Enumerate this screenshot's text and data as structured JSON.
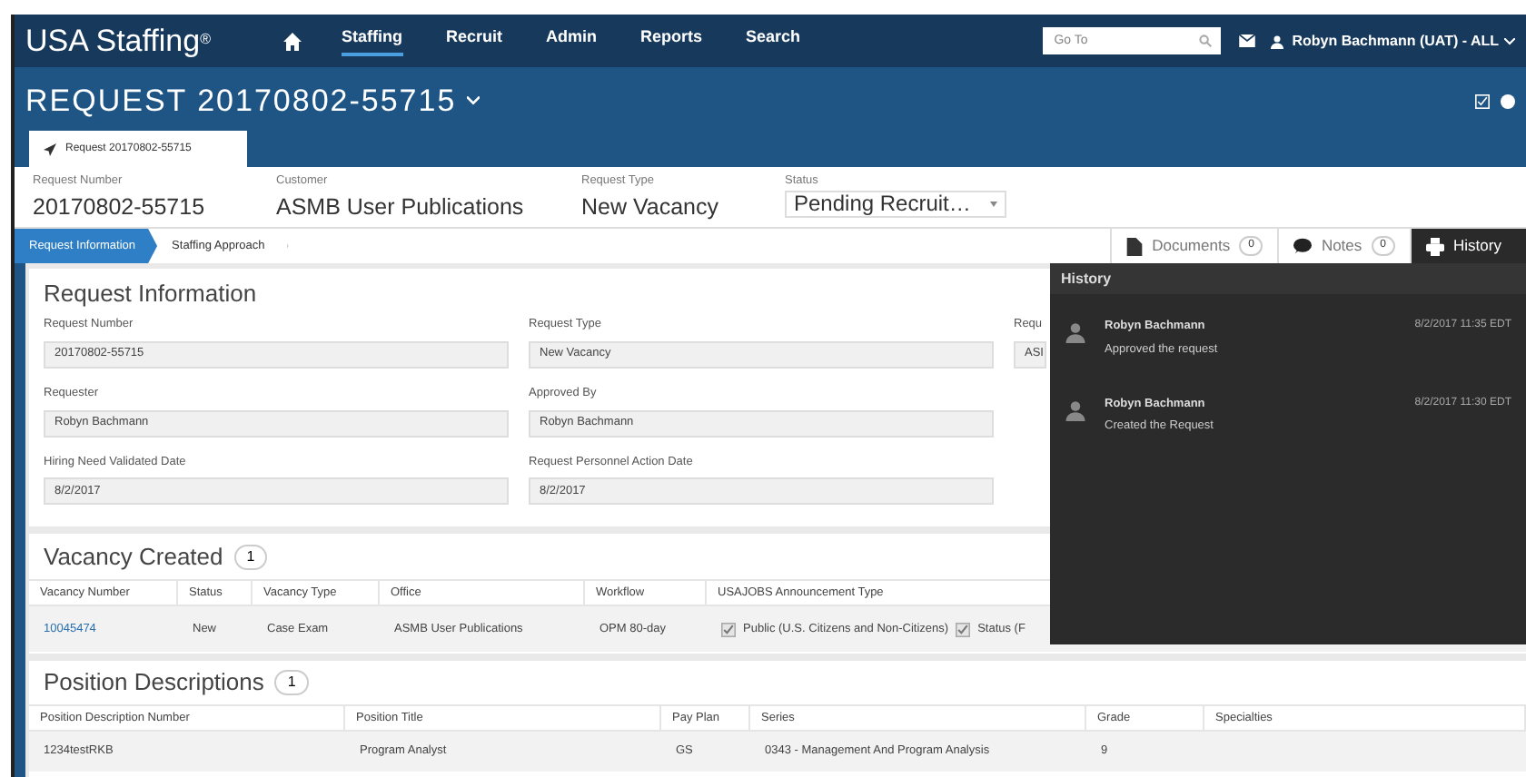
{
  "nav": {
    "logo": "USA Staffing",
    "logo_mark": "®",
    "items": [
      {
        "label": "Staffing",
        "selected": true
      },
      {
        "label": "Recruit",
        "selected": false
      },
      {
        "label": "Admin",
        "selected": false
      },
      {
        "label": "Reports",
        "selected": false
      },
      {
        "label": "Search",
        "selected": false
      }
    ],
    "goto": {
      "placeholder": "Go To"
    },
    "user": "Robyn Bachmann (UAT) - ALL"
  },
  "page_title": "REQUEST 20170802-55715",
  "record_tab": "Request 20170802-55715",
  "summary": [
    {
      "label": "Request Number",
      "value": "20170802-55715"
    },
    {
      "label": "Customer",
      "value": "ASMB User Publications"
    },
    {
      "label": "Request Type",
      "value": "New Vacancy"
    }
  ],
  "status": {
    "label": "Status",
    "value": "Pending Recruit…"
  },
  "steps": [
    {
      "label": "Request Information",
      "selected": true
    },
    {
      "label": "Staffing Approach",
      "selected": false
    }
  ],
  "side_tabs": [
    {
      "kind": "documents",
      "label": "Documents",
      "count": "0",
      "selected": false
    },
    {
      "kind": "notes",
      "label": "Notes",
      "count": "0",
      "selected": false
    },
    {
      "kind": "history",
      "label": "History",
      "selected": true
    }
  ],
  "request_information": {
    "title": "Request Information",
    "rows": [
      [
        {
          "label": "Request Number",
          "value": "20170802-55715"
        },
        {
          "label": "Request Type",
          "value": "New Vacancy"
        },
        {
          "label": "Requ",
          "value": "ASI"
        }
      ],
      [
        {
          "label": "Requester",
          "value": "Robyn Bachmann"
        },
        {
          "label": "Approved By",
          "value": "Robyn Bachmann"
        }
      ],
      [
        {
          "label": "Hiring Need Validated Date",
          "value": "8/2/2017"
        },
        {
          "label": "Request Personnel Action Date",
          "value": "8/2/2017"
        }
      ]
    ]
  },
  "vacancy": {
    "title": "Vacancy Created",
    "count": "1",
    "columns": [
      "Vacancy Number",
      "Status",
      "Vacancy Type",
      "Office",
      "Workflow",
      "USAJOBS Announcement Type"
    ],
    "rows": [
      {
        "number": "10045474",
        "status": "New",
        "type": "Case Exam",
        "office": "ASMB User Publications",
        "workflow": "OPM 80-day",
        "announcement_types": [
          {
            "label": "Public (U.S. Citizens and Non-Citizens)",
            "checked": true
          },
          {
            "label": "Status (F",
            "checked": true
          }
        ]
      }
    ]
  },
  "positions": {
    "title": "Position Descriptions",
    "count": "1",
    "columns": [
      "Position Description Number",
      "Position Title",
      "Pay Plan",
      "Series",
      "Grade",
      "Specialties"
    ],
    "rows": [
      [
        "1234testRKB",
        "Program Analyst",
        "GS",
        "0343 - Management And Program Analysis",
        "9"
      ]
    ]
  },
  "history": {
    "title": "History",
    "entries": [
      {
        "name": "Robyn Bachmann",
        "action": "Approved the request",
        "time": "8/2/2017 11:35 EDT"
      },
      {
        "name": "Robyn Bachmann",
        "action": "Created the Request",
        "time": "8/2/2017 11:30 EDT"
      }
    ]
  }
}
